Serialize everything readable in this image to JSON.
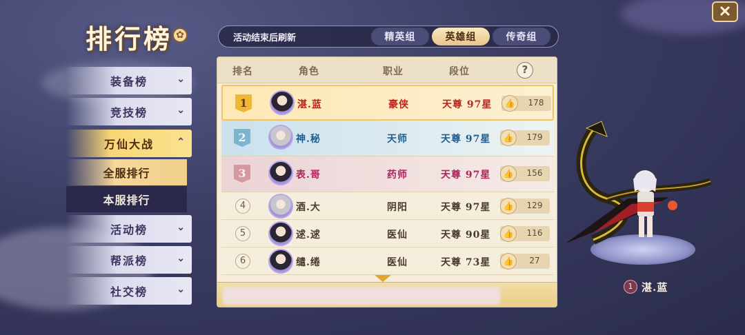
{
  "title": "排行榜",
  "sidebar": {
    "items": [
      {
        "label": "装备榜"
      },
      {
        "label": "竞技榜"
      },
      {
        "label": "万仙大战"
      },
      {
        "label": "活动榜"
      },
      {
        "label": "帮派榜"
      },
      {
        "label": "社交榜"
      }
    ],
    "sub_items": [
      {
        "label": "全服排行"
      },
      {
        "label": "本服排行"
      }
    ]
  },
  "topbar": {
    "note": "活动结束后刷新",
    "tabs": [
      {
        "label": "精英组"
      },
      {
        "label": "英雄组"
      },
      {
        "label": "传奇组"
      }
    ],
    "active_tab": "英雄组"
  },
  "table": {
    "headers": {
      "rank": "排名",
      "role": "角色",
      "job": "职业",
      "tier": "段位",
      "help": "?"
    },
    "rows": [
      {
        "rank": "1",
        "name": "湛.蓝",
        "job": "豪侠",
        "tier": "天尊 97星",
        "likes": "178"
      },
      {
        "rank": "2",
        "name": "神.秘",
        "job": "天师",
        "tier": "天尊 97星",
        "likes": "179"
      },
      {
        "rank": "3",
        "name": "表.哥",
        "job": "药师",
        "tier": "天尊 97星",
        "likes": "156"
      },
      {
        "rank": "4",
        "name": "酒.大",
        "job": "阴阳",
        "tier": "天尊 97星",
        "likes": "129"
      },
      {
        "rank": "5",
        "name": "逑.逑",
        "job": "医仙",
        "tier": "天尊 90星",
        "likes": "116"
      },
      {
        "rank": "6",
        "name": "缱.绻",
        "job": "医仙",
        "tier": "天尊 73星",
        "likes": "27"
      }
    ]
  },
  "showcase": {
    "rank": "1",
    "name": "湛.蓝"
  },
  "colors": {
    "gold": "#f0b737",
    "silver": "#7fb4cf",
    "bronze": "#d59aa1",
    "panel": "#f5ecda"
  },
  "icons": {
    "close": "close-icon",
    "like": "thumbs-up-icon",
    "gear": "gear-icon",
    "chevron": "chevron-down-icon"
  }
}
